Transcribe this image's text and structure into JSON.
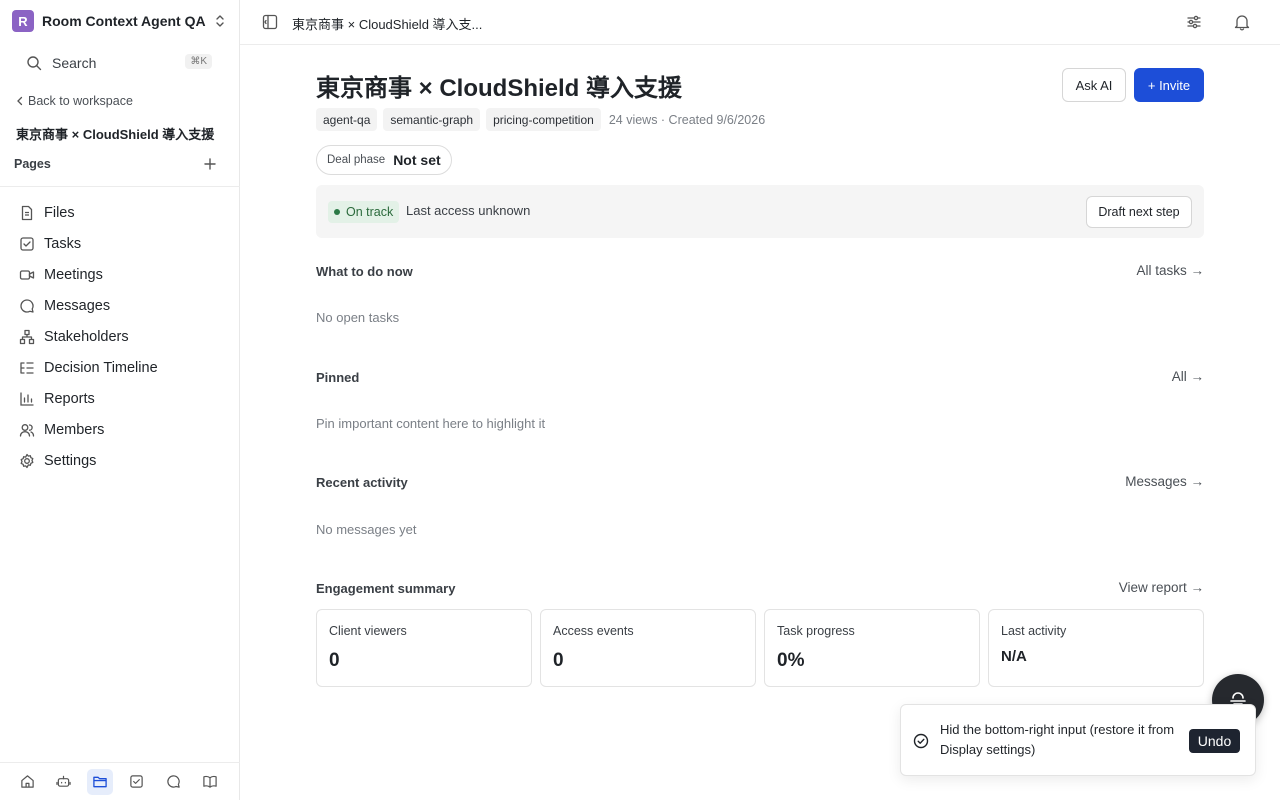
{
  "workspace": {
    "avatar_letter": "R",
    "name": "Room Context Agent QA",
    "avatar_color": "#8b63c4"
  },
  "search": {
    "label": "Search",
    "shortcut": "⌘K"
  },
  "sidebar": {
    "back_label": "Back to workspace",
    "room_title": "東京商事 × CloudShield 導入支援",
    "pages_header": "Pages",
    "items": [
      {
        "label": "Files",
        "icon": "file-icon"
      },
      {
        "label": "Tasks",
        "icon": "checkbox-icon"
      },
      {
        "label": "Meetings",
        "icon": "video-icon"
      },
      {
        "label": "Messages",
        "icon": "chat-bubble-icon"
      },
      {
        "label": "Stakeholders",
        "icon": "hierarchy-icon"
      },
      {
        "label": "Decision Timeline",
        "icon": "list-tree-icon"
      },
      {
        "label": "Reports",
        "icon": "bar-chart-icon"
      },
      {
        "label": "Members",
        "icon": "users-icon"
      },
      {
        "label": "Settings",
        "icon": "gear-icon"
      }
    ],
    "bottom_icons": [
      "home-icon",
      "bot-icon",
      "folder-icon",
      "checkbox-icon",
      "chat-bubble-icon",
      "book-icon"
    ]
  },
  "topbar": {
    "title": "東京商事 × CloudShield 導入支..."
  },
  "page": {
    "title": "東京商事 × CloudShield 導入支援",
    "ask_ai": "Ask AI",
    "invite": "+ Invite",
    "tags": [
      "agent-qa",
      "semantic-graph",
      "pricing-competition"
    ],
    "meta": "24 views · Created 9/6/2026",
    "deal_phase_label": "Deal phase",
    "deal_phase_value": "Not set",
    "status_badge": "On track",
    "status_text": "Last access unknown",
    "draft_button": "Draft next step",
    "accent_color": "#1d4ed8"
  },
  "sections": {
    "todo": {
      "title": "What to do now",
      "link": "All tasks →",
      "empty": "No open tasks"
    },
    "pinned": {
      "title": "Pinned",
      "link": "All →",
      "empty": "Pin important content here to highlight it"
    },
    "activity": {
      "title": "Recent activity",
      "link": "Messages →",
      "empty": "No messages yet"
    },
    "engagement": {
      "title": "Engagement summary",
      "link": "View report →"
    }
  },
  "engagement_cards": [
    {
      "label": "Client viewers",
      "value": "0"
    },
    {
      "label": "Access events",
      "value": "0"
    },
    {
      "label": "Task progress",
      "value": "0%"
    },
    {
      "label": "Last activity",
      "value": "N/A"
    }
  ],
  "toast": {
    "message": "Hid the bottom-right input (restore it from Display settings)",
    "undo": "Undo"
  }
}
